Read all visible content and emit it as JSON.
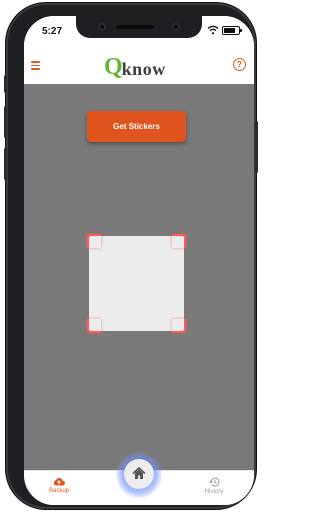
{
  "status_bar": {
    "time": "5:27",
    "wifi_icon": "wifi-icon",
    "battery_icon": "battery-icon",
    "battery_level": 0.75
  },
  "app_bar": {
    "menu_icon": "hamburger-menu-icon",
    "logo_mark": "Q",
    "logo_text": "know",
    "help_icon": "question-circle-icon",
    "help_glyph": "?"
  },
  "main": {
    "get_stickers_label": "Get Stickers"
  },
  "bottom_nav": {
    "items": [
      {
        "label": "Backup",
        "icon": "cloud-upload-icon",
        "active": true
      },
      {
        "label": "History",
        "icon": "history-icon",
        "active": false
      }
    ],
    "home_icon": "home-icon"
  },
  "colors": {
    "accent": "#e0541d",
    "logo_green": "#6bb132",
    "camera_background": "#7a7a7a",
    "scan_corner": "#ff5b5b"
  }
}
